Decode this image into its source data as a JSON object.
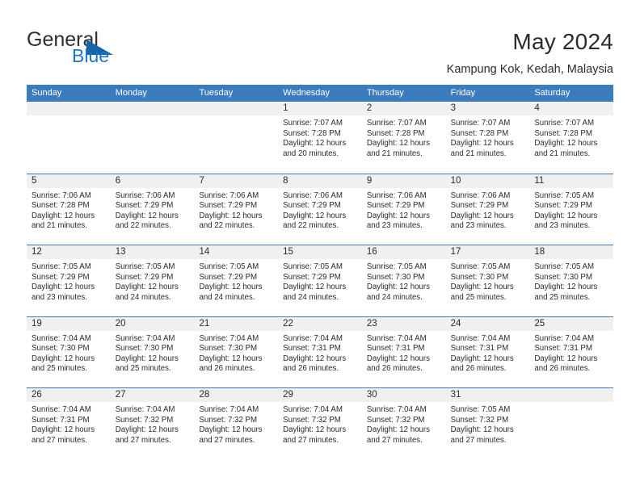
{
  "brand": {
    "name_top": "General",
    "name_bottom": "Blue",
    "triangle_icon": "triangle-icon",
    "accent_color": "#1b77c4",
    "header_color": "#3a7cbe"
  },
  "header": {
    "title": "May 2024",
    "location": "Kampung Kok, Kedah, Malaysia"
  },
  "calendar": {
    "day_names": [
      "Sunday",
      "Monday",
      "Tuesday",
      "Wednesday",
      "Thursday",
      "Friday",
      "Saturday"
    ],
    "weeks": [
      [
        {
          "date": "",
          "lines": []
        },
        {
          "date": "",
          "lines": []
        },
        {
          "date": "",
          "lines": []
        },
        {
          "date": "1",
          "lines": [
            "Sunrise: 7:07 AM",
            "Sunset: 7:28 PM",
            "Daylight: 12 hours",
            "and 20 minutes."
          ]
        },
        {
          "date": "2",
          "lines": [
            "Sunrise: 7:07 AM",
            "Sunset: 7:28 PM",
            "Daylight: 12 hours",
            "and 21 minutes."
          ]
        },
        {
          "date": "3",
          "lines": [
            "Sunrise: 7:07 AM",
            "Sunset: 7:28 PM",
            "Daylight: 12 hours",
            "and 21 minutes."
          ]
        },
        {
          "date": "4",
          "lines": [
            "Sunrise: 7:07 AM",
            "Sunset: 7:28 PM",
            "Daylight: 12 hours",
            "and 21 minutes."
          ]
        }
      ],
      [
        {
          "date": "5",
          "lines": [
            "Sunrise: 7:06 AM",
            "Sunset: 7:28 PM",
            "Daylight: 12 hours",
            "and 21 minutes."
          ]
        },
        {
          "date": "6",
          "lines": [
            "Sunrise: 7:06 AM",
            "Sunset: 7:29 PM",
            "Daylight: 12 hours",
            "and 22 minutes."
          ]
        },
        {
          "date": "7",
          "lines": [
            "Sunrise: 7:06 AM",
            "Sunset: 7:29 PM",
            "Daylight: 12 hours",
            "and 22 minutes."
          ]
        },
        {
          "date": "8",
          "lines": [
            "Sunrise: 7:06 AM",
            "Sunset: 7:29 PM",
            "Daylight: 12 hours",
            "and 22 minutes."
          ]
        },
        {
          "date": "9",
          "lines": [
            "Sunrise: 7:06 AM",
            "Sunset: 7:29 PM",
            "Daylight: 12 hours",
            "and 23 minutes."
          ]
        },
        {
          "date": "10",
          "lines": [
            "Sunrise: 7:06 AM",
            "Sunset: 7:29 PM",
            "Daylight: 12 hours",
            "and 23 minutes."
          ]
        },
        {
          "date": "11",
          "lines": [
            "Sunrise: 7:05 AM",
            "Sunset: 7:29 PM",
            "Daylight: 12 hours",
            "and 23 minutes."
          ]
        }
      ],
      [
        {
          "date": "12",
          "lines": [
            "Sunrise: 7:05 AM",
            "Sunset: 7:29 PM",
            "Daylight: 12 hours",
            "and 23 minutes."
          ]
        },
        {
          "date": "13",
          "lines": [
            "Sunrise: 7:05 AM",
            "Sunset: 7:29 PM",
            "Daylight: 12 hours",
            "and 24 minutes."
          ]
        },
        {
          "date": "14",
          "lines": [
            "Sunrise: 7:05 AM",
            "Sunset: 7:29 PM",
            "Daylight: 12 hours",
            "and 24 minutes."
          ]
        },
        {
          "date": "15",
          "lines": [
            "Sunrise: 7:05 AM",
            "Sunset: 7:29 PM",
            "Daylight: 12 hours",
            "and 24 minutes."
          ]
        },
        {
          "date": "16",
          "lines": [
            "Sunrise: 7:05 AM",
            "Sunset: 7:30 PM",
            "Daylight: 12 hours",
            "and 24 minutes."
          ]
        },
        {
          "date": "17",
          "lines": [
            "Sunrise: 7:05 AM",
            "Sunset: 7:30 PM",
            "Daylight: 12 hours",
            "and 25 minutes."
          ]
        },
        {
          "date": "18",
          "lines": [
            "Sunrise: 7:05 AM",
            "Sunset: 7:30 PM",
            "Daylight: 12 hours",
            "and 25 minutes."
          ]
        }
      ],
      [
        {
          "date": "19",
          "lines": [
            "Sunrise: 7:04 AM",
            "Sunset: 7:30 PM",
            "Daylight: 12 hours",
            "and 25 minutes."
          ]
        },
        {
          "date": "20",
          "lines": [
            "Sunrise: 7:04 AM",
            "Sunset: 7:30 PM",
            "Daylight: 12 hours",
            "and 25 minutes."
          ]
        },
        {
          "date": "21",
          "lines": [
            "Sunrise: 7:04 AM",
            "Sunset: 7:30 PM",
            "Daylight: 12 hours",
            "and 26 minutes."
          ]
        },
        {
          "date": "22",
          "lines": [
            "Sunrise: 7:04 AM",
            "Sunset: 7:31 PM",
            "Daylight: 12 hours",
            "and 26 minutes."
          ]
        },
        {
          "date": "23",
          "lines": [
            "Sunrise: 7:04 AM",
            "Sunset: 7:31 PM",
            "Daylight: 12 hours",
            "and 26 minutes."
          ]
        },
        {
          "date": "24",
          "lines": [
            "Sunrise: 7:04 AM",
            "Sunset: 7:31 PM",
            "Daylight: 12 hours",
            "and 26 minutes."
          ]
        },
        {
          "date": "25",
          "lines": [
            "Sunrise: 7:04 AM",
            "Sunset: 7:31 PM",
            "Daylight: 12 hours",
            "and 26 minutes."
          ]
        }
      ],
      [
        {
          "date": "26",
          "lines": [
            "Sunrise: 7:04 AM",
            "Sunset: 7:31 PM",
            "Daylight: 12 hours",
            "and 27 minutes."
          ]
        },
        {
          "date": "27",
          "lines": [
            "Sunrise: 7:04 AM",
            "Sunset: 7:32 PM",
            "Daylight: 12 hours",
            "and 27 minutes."
          ]
        },
        {
          "date": "28",
          "lines": [
            "Sunrise: 7:04 AM",
            "Sunset: 7:32 PM",
            "Daylight: 12 hours",
            "and 27 minutes."
          ]
        },
        {
          "date": "29",
          "lines": [
            "Sunrise: 7:04 AM",
            "Sunset: 7:32 PM",
            "Daylight: 12 hours",
            "and 27 minutes."
          ]
        },
        {
          "date": "30",
          "lines": [
            "Sunrise: 7:04 AM",
            "Sunset: 7:32 PM",
            "Daylight: 12 hours",
            "and 27 minutes."
          ]
        },
        {
          "date": "31",
          "lines": [
            "Sunrise: 7:05 AM",
            "Sunset: 7:32 PM",
            "Daylight: 12 hours",
            "and 27 minutes."
          ]
        },
        {
          "date": "",
          "lines": []
        }
      ]
    ]
  }
}
